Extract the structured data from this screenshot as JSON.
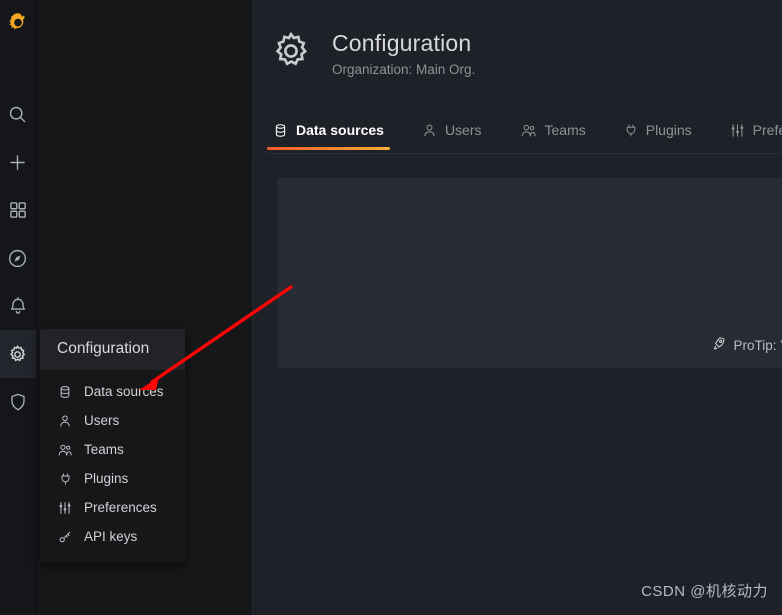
{
  "nav_rail": {
    "brand": {
      "icon": "grafana-logo-icon"
    },
    "items": [
      {
        "icon": "search-icon",
        "name": "search"
      },
      {
        "icon": "plus-icon",
        "name": "create"
      },
      {
        "icon": "dashboards-icon",
        "name": "dashboards"
      },
      {
        "icon": "compass-icon",
        "name": "explore"
      },
      {
        "icon": "bell-icon",
        "name": "alerting"
      },
      {
        "icon": "gear-icon",
        "name": "configuration",
        "active": true
      },
      {
        "icon": "shield-icon",
        "name": "server-admin"
      }
    ]
  },
  "header": {
    "icon": "gear-icon",
    "title": "Configuration",
    "subtitle": "Organization: Main Org."
  },
  "tabs": [
    {
      "label": "Data sources",
      "icon": "database-icon",
      "active": true
    },
    {
      "label": "Users",
      "icon": "user-icon",
      "active": false
    },
    {
      "label": "Teams",
      "icon": "users-icon",
      "active": false
    },
    {
      "label": "Plugins",
      "icon": "plug-icon",
      "active": false
    },
    {
      "label": "Prefer",
      "icon": "sliders-icon",
      "active": false
    }
  ],
  "datasource_card": {
    "protip_icon": "rocket-icon",
    "protip_text": "ProTip: Y"
  },
  "flyout": {
    "title": "Configuration",
    "items": [
      {
        "label": "Data sources",
        "icon": "database-icon"
      },
      {
        "label": "Users",
        "icon": "user-icon"
      },
      {
        "label": "Teams",
        "icon": "users-icon"
      },
      {
        "label": "Plugins",
        "icon": "plug-icon"
      },
      {
        "label": "Preferences",
        "icon": "sliders-icon"
      },
      {
        "label": "API keys",
        "icon": "key-icon"
      }
    ]
  },
  "annotation": {
    "arrow_color": "#fb0606",
    "points_at": "Data sources"
  },
  "watermark": {
    "text": "CSDN @机核动力"
  },
  "colors": {
    "accent_orange": "#f05a28",
    "accent_yellow": "#fbad37",
    "page_bg": "#1f2128",
    "rail_bg": "#141619",
    "menu_bg": "#161719",
    "card_bg": "#282b33"
  }
}
